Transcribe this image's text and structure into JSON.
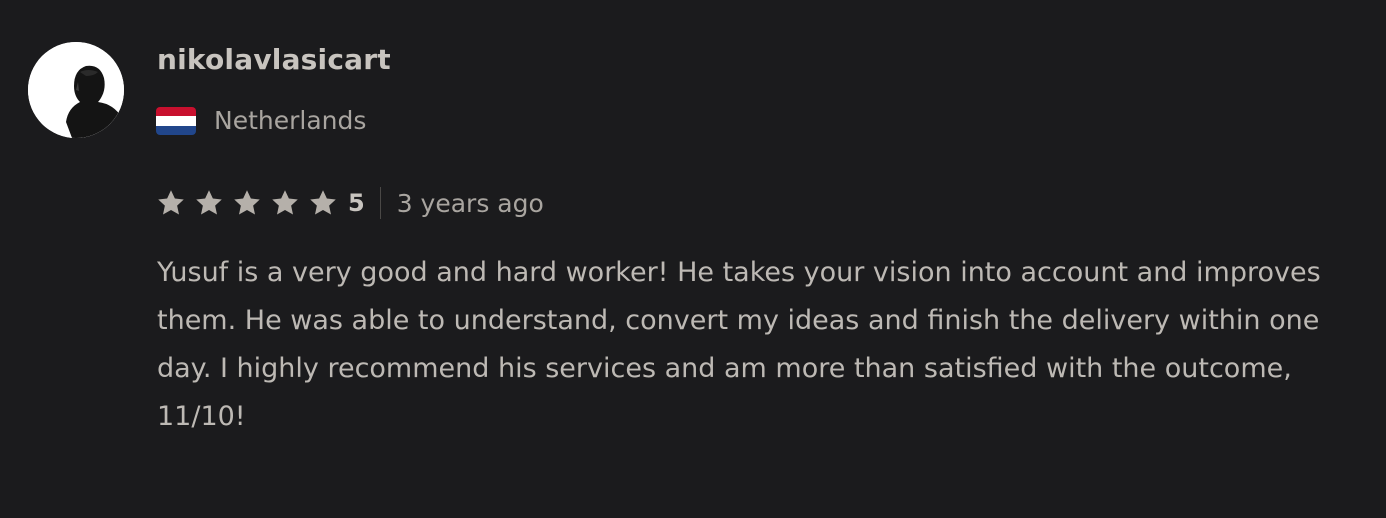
{
  "review": {
    "username": "nikolavlasicart",
    "country": "Netherlands",
    "flag_colors": [
      "#c8102e",
      "#ffffff",
      "#21468b"
    ],
    "stars": [
      {
        "icon": "star-icon"
      },
      {
        "icon": "star-icon"
      },
      {
        "icon": "star-icon"
      },
      {
        "icon": "star-icon"
      },
      {
        "icon": "star-icon"
      }
    ],
    "rating": "5",
    "rating_stars_filled": 5,
    "time_ago": "3 years ago",
    "text": "Yusuf is a very good and hard worker! He takes your vision into account and improves them. He was able to understand, convert my ideas and finish the delivery within one day. I highly recommend his services and am more than satisfied with the outcome, 11/10!",
    "star_color": "#b5b0aa",
    "avatar_icon": "user-avatar"
  }
}
